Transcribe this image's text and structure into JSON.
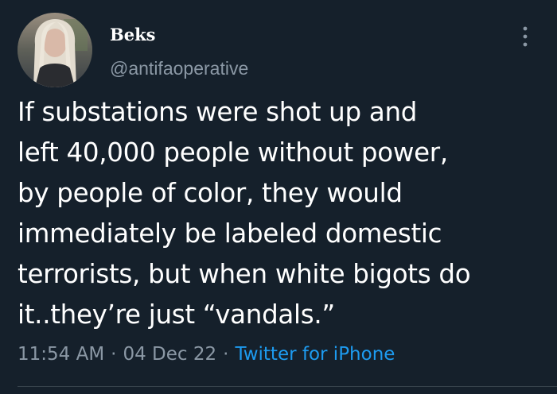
{
  "tweet": {
    "author": {
      "display_name": "Beks",
      "username": "@antifaoperative"
    },
    "text": "If substations were shot up and\nleft 40,000 people without power,\nby people of color, they would\nimmediately be labeled domestic\nterrorists, but when white bigots do\nit..they’re just “vandals.”",
    "time": "11:54 AM",
    "date": "04 Dec 22",
    "separator": "·",
    "source": "Twitter for iPhone"
  },
  "icons": {
    "more": "more-vertical-icon"
  },
  "colors": {
    "background": "#15202b",
    "text_primary": "#ffffff",
    "text_secondary": "#8b98a5",
    "link": "#1d9bf0",
    "divider": "#38444d"
  }
}
